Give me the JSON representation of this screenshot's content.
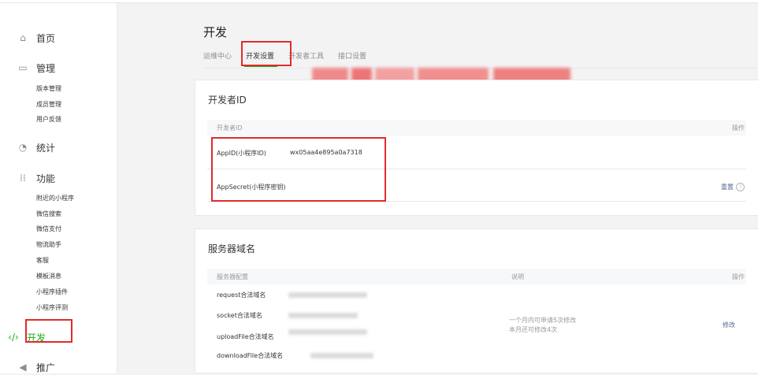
{
  "sidebar": {
    "home": "首页",
    "manage": "管理",
    "manage_items": [
      "版本管理",
      "成员管理",
      "用户反馈"
    ],
    "stats": "统计",
    "features": "功能",
    "feature_items": [
      "附近的小程序",
      "微信搜索",
      "微信支付",
      "物流助手",
      "客服",
      "模板消息",
      "小程序插件",
      "小程序评测"
    ],
    "develop": "开发",
    "promote": "推广"
  },
  "page_title": "开发",
  "tabs": [
    "运维中心",
    "开发设置",
    "开发者工具",
    "接口设置"
  ],
  "active_tab": "开发设置",
  "dev_id": {
    "title": "开发者ID",
    "col_id": "开发者ID",
    "col_action": "操作",
    "appid_label": "AppID(小程序ID)",
    "appid_value": "wx05aa4e895a0a7318",
    "secret_label": "AppSecret(小程序密钥)",
    "reset": "重置"
  },
  "server": {
    "title": "服务器域名",
    "col_config": "服务器配置",
    "col_desc": "说明",
    "col_action": "操作",
    "rows": [
      "request合法域名",
      "socket合法域名",
      "uploadFile合法域名",
      "downloadFile合法域名"
    ],
    "desc_line1": "一个月内可申请5次修改",
    "desc_line2": "本月还可修改4次",
    "edit": "修改"
  },
  "colors": {
    "accent": "#1aad19",
    "highlight": "#e02b2b",
    "link": "#576b95"
  }
}
